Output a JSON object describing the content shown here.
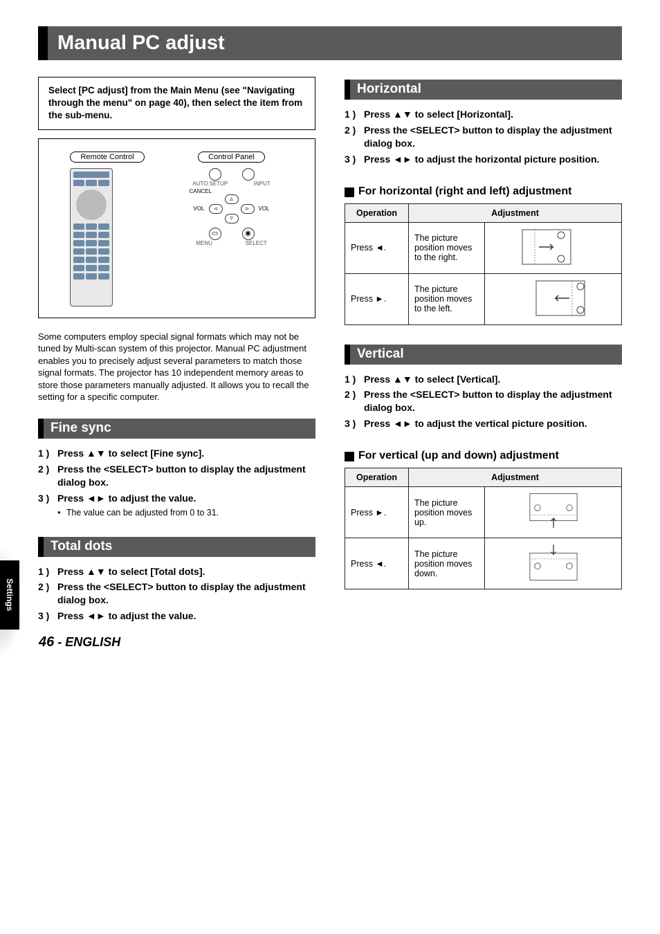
{
  "page": {
    "title": "Manual PC adjust",
    "side_tab": "Settings",
    "page_number": "46",
    "page_lang": " - ENGLISH"
  },
  "intro": {
    "box": "Select [PC adjust] from the Main Menu (see \"Navigating through the menu\" on page 40), then select the item from the sub-menu.",
    "labels": {
      "remote": "Remote Control",
      "panel": "Control Panel",
      "auto": "AUTO SETUP",
      "input": "INPUT",
      "cancel": "CANCEL",
      "volm": "VOL",
      "volp": "VOL",
      "menu": "MENU",
      "select": "SELECT"
    },
    "body": "Some computers employ special signal formats which may not be tuned by Multi-scan system of this projector. Manual PC adjustment enables you to precisely adjust several parameters to match those signal formats. The projector has 10 independent memory areas to store those parameters manually adjusted. It allows you to recall the setting for a specific computer."
  },
  "fine_sync": {
    "title": "Fine sync",
    "steps": [
      "Press ▲▼ to select [Fine sync].",
      "Press the <SELECT> button to display the adjustment dialog box.",
      "Press ◄► to adjust the value."
    ],
    "note": "The value can be adjusted from 0 to 31."
  },
  "total_dots": {
    "title": "Total dots",
    "steps": [
      "Press ▲▼ to select [Total dots].",
      "Press the <SELECT> button to display the adjustment dialog box.",
      "Press ◄► to adjust the value."
    ]
  },
  "horizontal": {
    "title": "Horizontal",
    "steps": [
      "Press ▲▼ to select [Horizontal].",
      "Press the <SELECT> button to display the adjustment dialog box.",
      "Press ◄► to adjust the horizontal picture position."
    ],
    "sub": "For horizontal (right and left) adjustment",
    "th_op": "Operation",
    "th_adj": "Adjustment",
    "rows": [
      {
        "op": "Press ◄.",
        "adj": "The picture position moves to the right."
      },
      {
        "op": "Press ►.",
        "adj": "The picture position moves to the left."
      }
    ]
  },
  "vertical": {
    "title": "Vertical",
    "steps": [
      "Press ▲▼ to select [Vertical].",
      "Press the <SELECT> button to display the adjustment dialog box.",
      "Press ◄► to adjust the vertical picture position."
    ],
    "sub": "For vertical (up and down) adjustment",
    "th_op": "Operation",
    "th_adj": "Adjustment",
    "rows": [
      {
        "op": "Press ►.",
        "adj": "The picture position moves up."
      },
      {
        "op": "Press ◄.",
        "adj": "The picture position moves down."
      }
    ]
  }
}
